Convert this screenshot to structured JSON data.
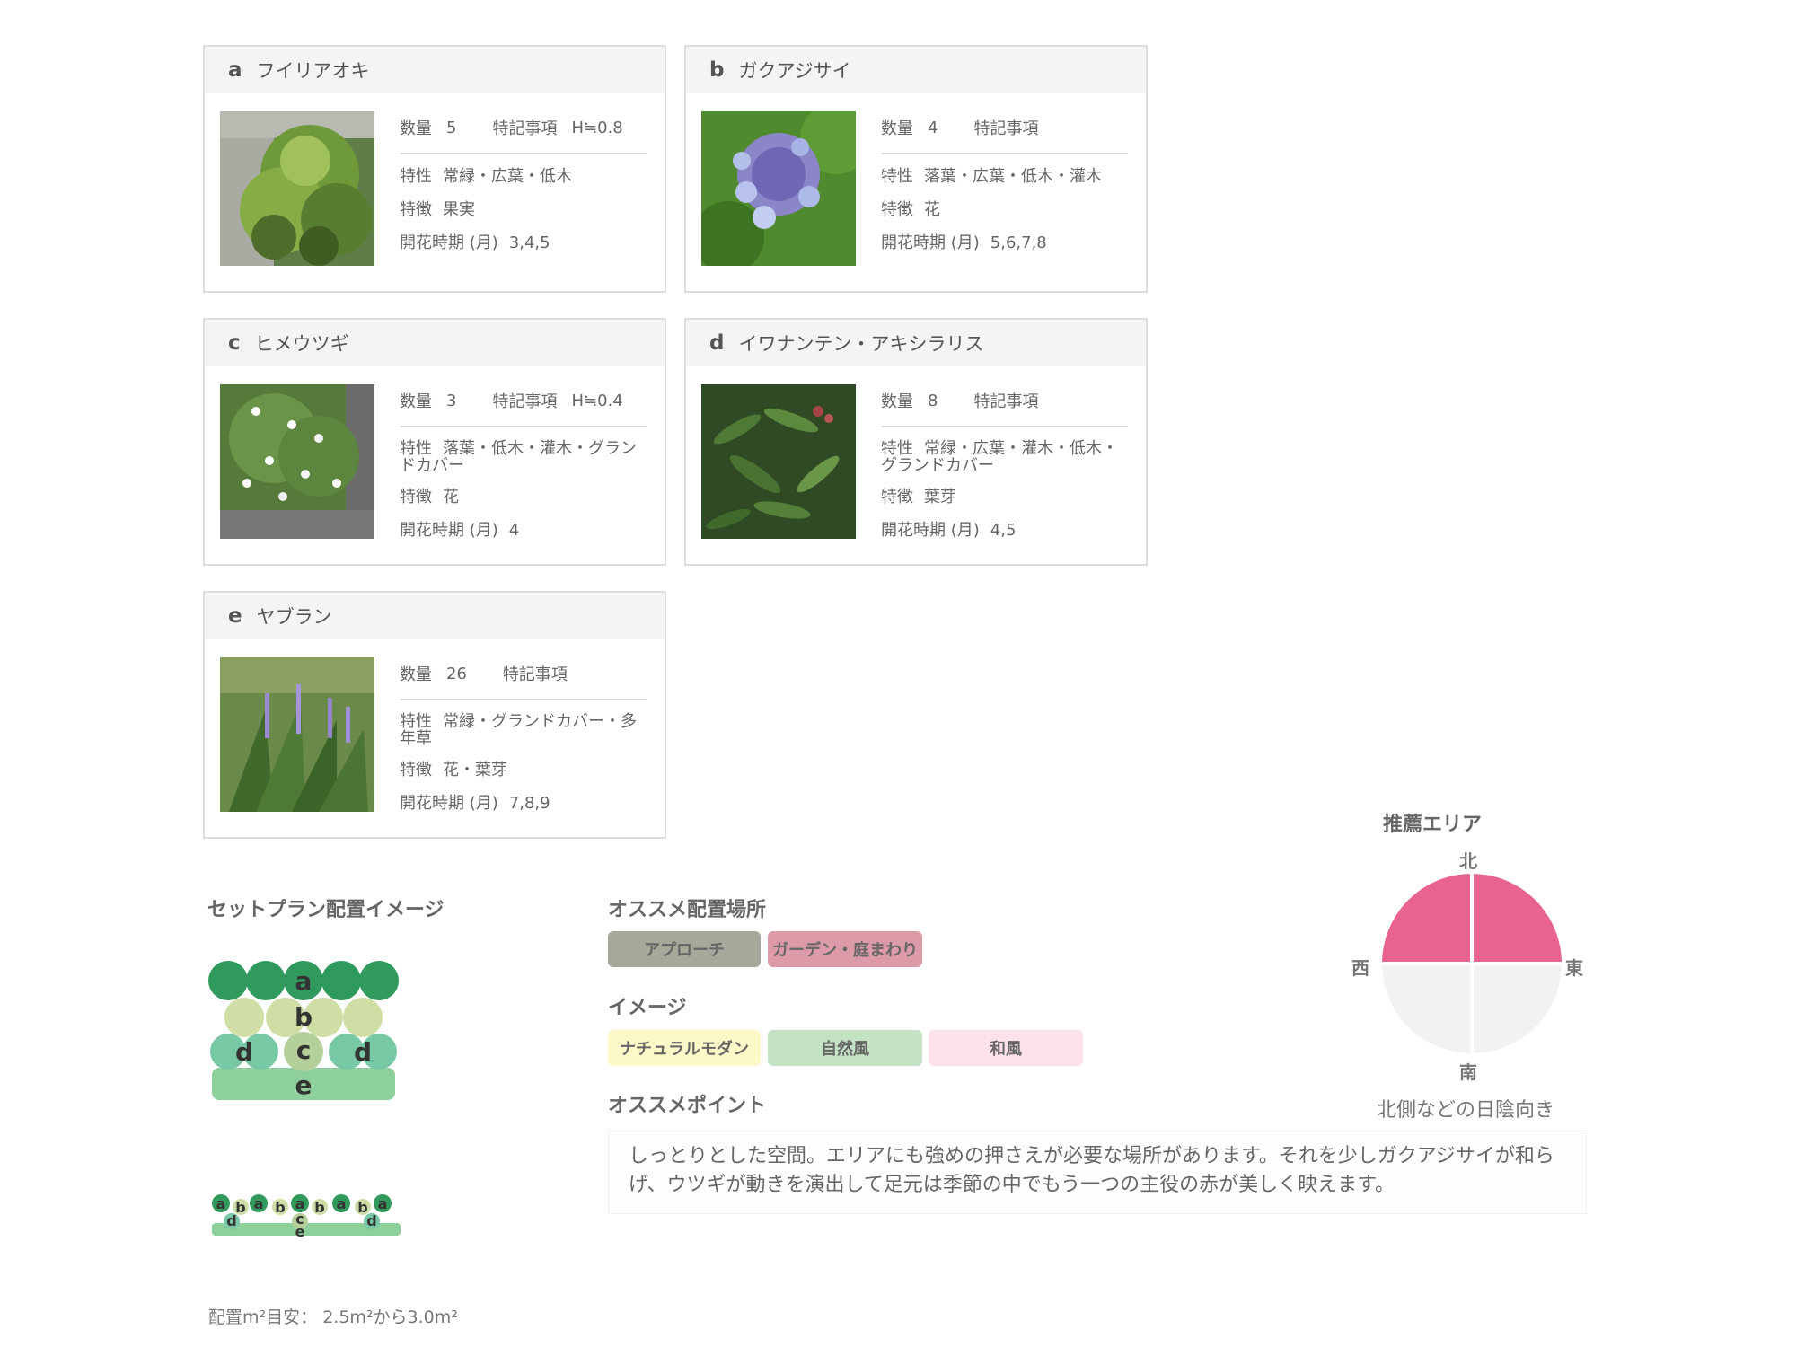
{
  "plants": [
    {
      "letter": "a",
      "name": "フイリアオキ",
      "qty_label": "数量",
      "qty": "5",
      "note_label": "特記事項",
      "note": "H≒0.8",
      "trait_label": "特性",
      "trait": "常緑・広葉・低木",
      "feature_label": "特徴",
      "feature": "果実",
      "bloom_label": "開花時期 (月)",
      "bloom": "3,4,5"
    },
    {
      "letter": "b",
      "name": "ガクアジサイ",
      "qty_label": "数量",
      "qty": "4",
      "note_label": "特記事項",
      "note": "",
      "trait_label": "特性",
      "trait": "落葉・広葉・低木・灌木",
      "feature_label": "特徴",
      "feature": "花",
      "bloom_label": "開花時期 (月)",
      "bloom": "5,6,7,8"
    },
    {
      "letter": "c",
      "name": "ヒメウツギ",
      "qty_label": "数量",
      "qty": "3",
      "note_label": "特記事項",
      "note": "H≒0.4",
      "trait_label": "特性",
      "trait": "落葉・低木・灌木・グランドカバー",
      "feature_label": "特徴",
      "feature": "花",
      "bloom_label": "開花時期 (月)",
      "bloom": "4"
    },
    {
      "letter": "d",
      "name": "イワナンテン・アキシラリス",
      "qty_label": "数量",
      "qty": "8",
      "note_label": "特記事項",
      "note": "",
      "trait_label": "特性",
      "trait": "常緑・広葉・灌木・低木・グランドカバー",
      "feature_label": "特徴",
      "feature": "葉芽",
      "bloom_label": "開花時期 (月)",
      "bloom": "4,5"
    },
    {
      "letter": "e",
      "name": "ヤブラン",
      "qty_label": "数量",
      "qty": "26",
      "note_label": "特記事項",
      "note": "",
      "trait_label": "特性",
      "trait": "常緑・グランドカバー・多年草",
      "feature_label": "特徴",
      "feature": "花・葉芽",
      "bloom_label": "開花時期 (月)",
      "bloom": "7,8,9"
    }
  ],
  "layout": {
    "title": "セットプラン配置イメージ",
    "area_label": "配置m²目安：",
    "area_value": "2.5m²から3.0m²"
  },
  "placement": {
    "title": "オススメ配置場所",
    "tags": [
      {
        "label": "アプローチ",
        "color": "#a5a99a"
      },
      {
        "label": "ガーデン・庭まわり",
        "color": "#dd9aa8"
      }
    ]
  },
  "image": {
    "title": "イメージ",
    "tags": [
      {
        "label": "ナチュラルモダン",
        "color": "#fcf8c8"
      },
      {
        "label": "自然風",
        "color": "#c4e2c4"
      },
      {
        "label": "和風",
        "color": "#fde2ea"
      }
    ]
  },
  "point": {
    "title": "オススメポイント",
    "text": "しっとりとした空間。エリアにも強めの押さえが必要な場所があります。それを少しガクアジサイが和らげ、ウツギが動きを演出して足元は季節の中でもう一つの主役の赤が美しく映えます。"
  },
  "area": {
    "title": "推薦エリア",
    "north": "北",
    "south": "南",
    "west": "西",
    "east": "東",
    "note": "北側などの日陰向き",
    "active_color": "#e96391",
    "inactive_color": "#f2f2f2"
  }
}
